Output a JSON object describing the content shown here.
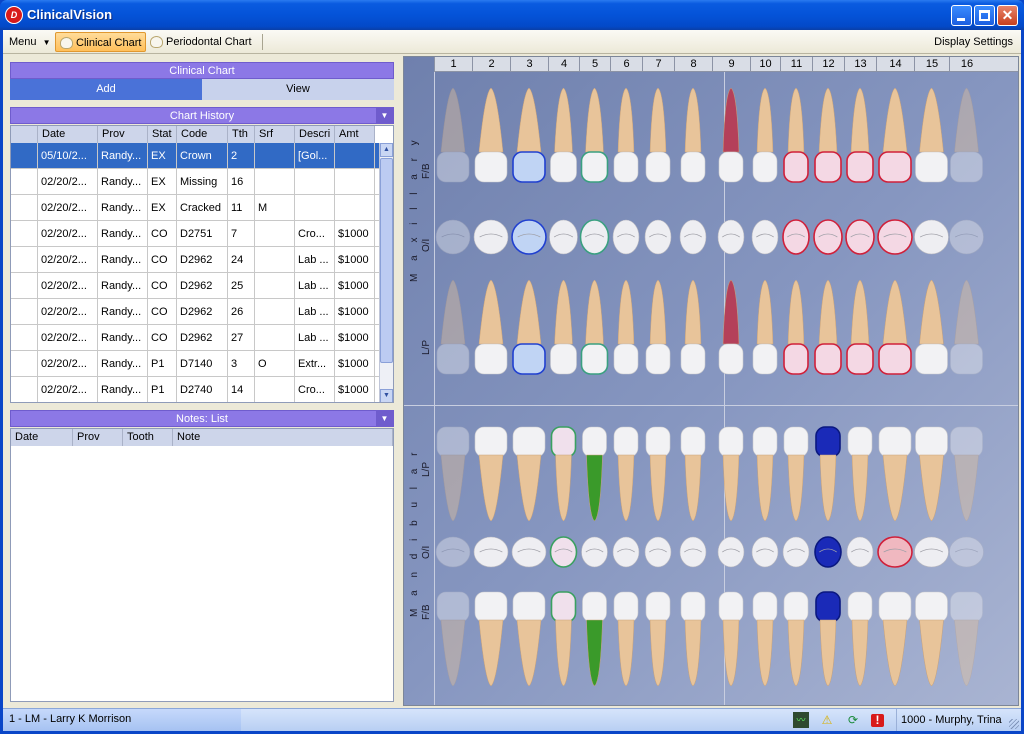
{
  "window": {
    "title": "ClinicalVision",
    "logo_text": "D"
  },
  "toolbar": {
    "menu_label": "Menu",
    "clinical_chart_label": "Clinical Chart",
    "periodontal_chart_label": "Periodontal Chart",
    "display_settings_label": "Display Settings"
  },
  "clinical_chart_panel": {
    "title": "Clinical Chart",
    "add_label": "Add",
    "view_label": "View"
  },
  "chart_history": {
    "title": "Chart History",
    "columns": [
      "Date",
      "Prov",
      "Stat",
      "Code",
      "Tth",
      "Srf",
      "Descri",
      "Amt"
    ],
    "rows": [
      [
        "05/10/2...",
        "Randy...",
        "EX",
        "Crown",
        "2",
        "",
        "[Gol...",
        ""
      ],
      [
        "02/20/2...",
        "Randy...",
        "EX",
        "Missing",
        "16",
        "",
        "",
        ""
      ],
      [
        "02/20/2...",
        "Randy...",
        "EX",
        "Cracked",
        "11",
        "M",
        "",
        ""
      ],
      [
        "02/20/2...",
        "Randy...",
        "CO",
        "D2751",
        "7",
        "",
        "Cro...",
        "$1000"
      ],
      [
        "02/20/2...",
        "Randy...",
        "CO",
        "D2962",
        "24",
        "",
        "Lab ...",
        "$1000"
      ],
      [
        "02/20/2...",
        "Randy...",
        "CO",
        "D2962",
        "25",
        "",
        "Lab ...",
        "$1000"
      ],
      [
        "02/20/2...",
        "Randy...",
        "CO",
        "D2962",
        "26",
        "",
        "Lab ...",
        "$1000"
      ],
      [
        "02/20/2...",
        "Randy...",
        "CO",
        "D2962",
        "27",
        "",
        "Lab ...",
        "$1000"
      ],
      [
        "02/20/2...",
        "Randy...",
        "P1",
        "D7140",
        "3",
        "O",
        "Extr...",
        "$1000"
      ],
      [
        "02/20/2...",
        "Randy...",
        "P1",
        "D2740",
        "14",
        "",
        "Cro...",
        "$1000"
      ]
    ]
  },
  "notes_list": {
    "title": "Notes: List",
    "columns": [
      "Date",
      "Prov",
      "Tooth",
      "Note"
    ]
  },
  "dental_chart": {
    "tooth_numbers": [
      "1",
      "2",
      "3",
      "4",
      "5",
      "6",
      "7",
      "8",
      "9",
      "10",
      "11",
      "12",
      "13",
      "14",
      "15",
      "16"
    ],
    "maxillary_label": "M a x i l l a r y",
    "mandibular_label": "M a n d i b u l a r",
    "row_labels_upper": [
      "F/B",
      "O/I",
      "L/P"
    ],
    "row_labels_lower": [
      "L/P",
      "O/I",
      "F/B"
    ]
  },
  "status_bar": {
    "patient": "1 - LM - Larry K Morrison",
    "provider": "1000 - Murphy, Trina"
  }
}
